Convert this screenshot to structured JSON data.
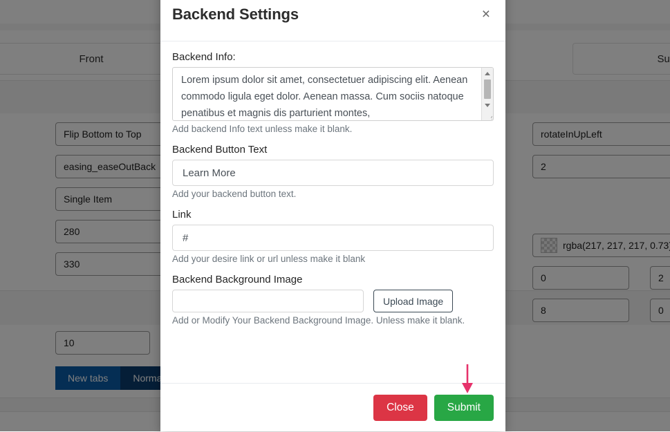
{
  "background_page": {
    "columns": [
      {
        "label": "Front"
      },
      {
        "label": "Supp"
      }
    ],
    "fields": [
      {
        "value": "Flip Bottom to Top"
      },
      {
        "value": "easing_easeOutBack"
      },
      {
        "value": "Single Item"
      },
      {
        "value": "280"
      },
      {
        "value": "330"
      },
      {
        "value": "10"
      },
      {
        "value": "rotateInUpLeft"
      },
      {
        "value": "2"
      },
      {
        "value": "rgba(217, 217, 217, 0.73)"
      },
      {
        "value": "0"
      },
      {
        "value": "2"
      },
      {
        "value": "8"
      },
      {
        "value": "0"
      }
    ],
    "buttons": [
      {
        "label": "New tabs"
      },
      {
        "label": "Normal"
      }
    ]
  },
  "modal": {
    "title": "Backend Settings",
    "close_icon": "close-icon",
    "close_icon_glyph": "×",
    "fields": {
      "backend_info": {
        "label": "Backend Info:",
        "value": "Lorem ipsum dolor sit amet, consectetuer adipiscing elit. Aenean commodo ligula eget dolor. Aenean massa. Cum sociis natoque penatibus et magnis dis parturient montes,",
        "help": "Add backend Info text unless make it blank."
      },
      "button_text": {
        "label": "Backend Button Text",
        "value": "Learn More",
        "help": "Add your backend button text."
      },
      "link": {
        "label": "Link",
        "value": "#",
        "help": "Add your desire link or url unless make it blank"
      },
      "background_image": {
        "label": "Backend Background Image",
        "value": "",
        "upload_label": "Upload Image",
        "help": "Add or Modify Your Backend Background Image. Unless make it blank."
      }
    },
    "footer": {
      "close_label": "Close",
      "submit_label": "Submit"
    }
  },
  "annotation": {
    "arrow_name": "down-arrow-annotation",
    "color": "#e6326b"
  },
  "colors": {
    "close_button": "#dc3545",
    "submit_button": "#28a745",
    "overlay": "rgba(0, 0, 0, 0.5)",
    "primary_blue": "#0b5ca8",
    "dark_blue": "#0a3d6e"
  }
}
